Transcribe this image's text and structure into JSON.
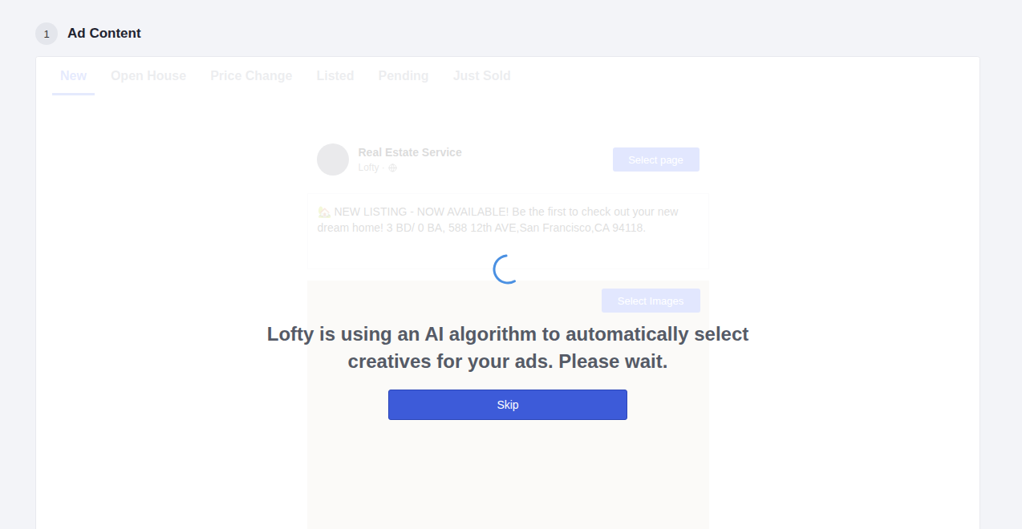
{
  "section": {
    "number": "1",
    "title": "Ad Content"
  },
  "tabs": [
    {
      "label": "New",
      "selected": true
    },
    {
      "label": "Open House",
      "selected": false
    },
    {
      "label": "Price Change",
      "selected": false
    },
    {
      "label": "Listed",
      "selected": false
    },
    {
      "label": "Pending",
      "selected": false
    },
    {
      "label": "Just Sold",
      "selected": false
    }
  ],
  "preview": {
    "page_name": "Real Estate Service",
    "page_meta": "Lofty ·",
    "select_page": "Select page",
    "caption": "🏡 NEW LISTING - NOW AVAILABLE! Be the first to check out your new dream home! 3 BD/ 0 BA, 588 12th AVE,San Francisco,CA 94118.",
    "select_images": "Select Images"
  },
  "loading": {
    "message": "Lofty is using an AI algorithm to automatically select creatives for your ads. Please wait.",
    "skip": "Skip"
  }
}
